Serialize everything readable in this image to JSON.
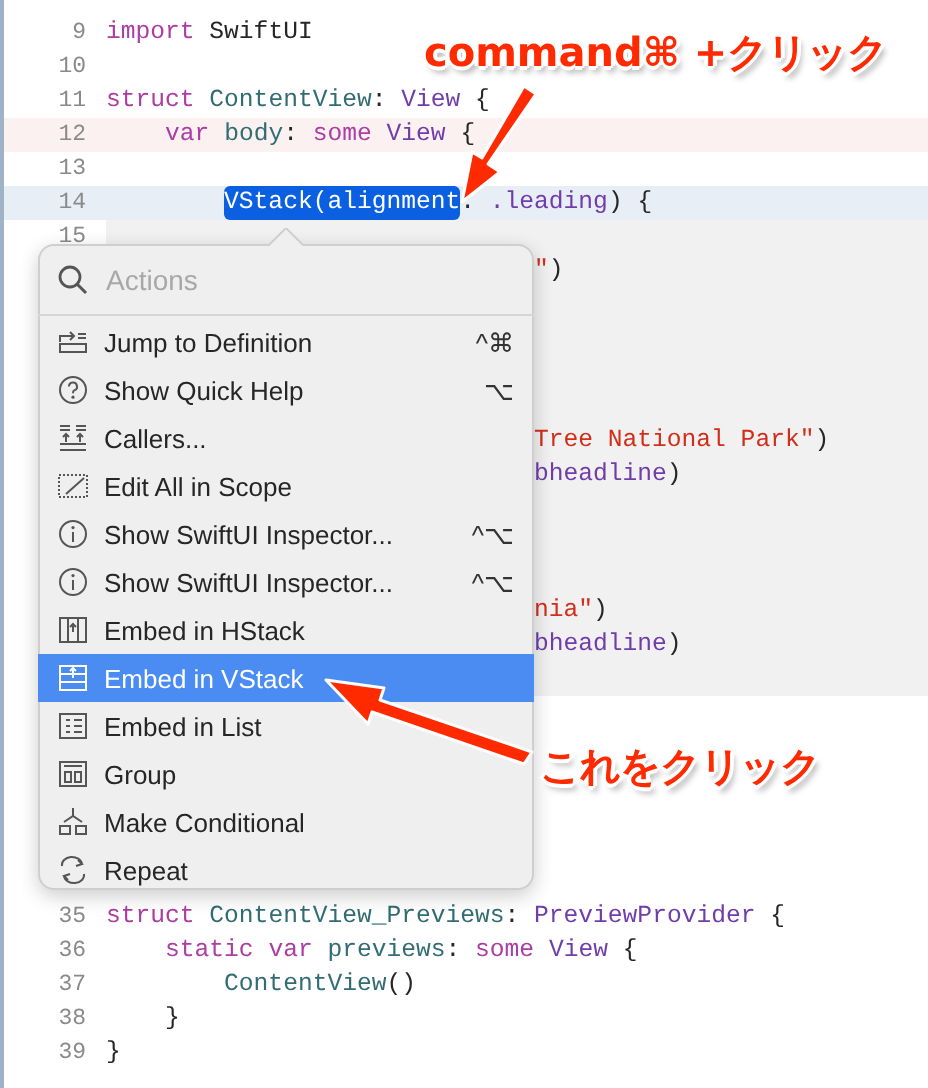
{
  "editor": {
    "lines": [
      {
        "number": "9",
        "tokens": [
          {
            "kind": "keyword",
            "text": "import"
          },
          {
            "kind": "plain",
            "text": " SwiftUI"
          }
        ]
      },
      {
        "number": "10"
      },
      {
        "number": "11",
        "tokens": [
          {
            "kind": "keyword",
            "text": "struct"
          },
          {
            "kind": "decl",
            "text": " ContentView"
          },
          {
            "kind": "plain",
            "text": ": "
          },
          {
            "kind": "type",
            "text": "View"
          },
          {
            "kind": "plain",
            "text": " {"
          }
        ]
      },
      {
        "number": "12",
        "color": "#fcf1f1",
        "tokens": [
          {
            "kind": "keyword",
            "text": "    var"
          },
          {
            "kind": "decl",
            "text": " body"
          },
          {
            "kind": "plain",
            "text": ": "
          },
          {
            "kind": "keyword",
            "text": "some"
          },
          {
            "kind": "type",
            "text": " View"
          },
          {
            "kind": "plain",
            "text": " {"
          }
        ]
      },
      {
        "number": "13"
      },
      {
        "number": "14",
        "color": "#e8eef6",
        "tokens": [
          {
            "kind": "selected",
            "text": "        VStack(alignment"
          },
          {
            "kind": "plain",
            "text": ": "
          },
          {
            "kind": "type",
            "text": ".leading"
          },
          {
            "kind": "plain",
            "text": ") {"
          }
        ]
      },
      {
        "number": "15",
        "color": "#f1f1f1"
      },
      {
        "color": "#f1f1f1",
        "partial": true,
        "tokens": [
          {
            "kind": "string",
            "text": "\""
          },
          {
            "kind": "plain",
            "text": ")"
          }
        ]
      },
      {
        "color": "#f1f1f1"
      },
      {
        "color": "#f1f1f1"
      },
      {
        "color": "#f1f1f1"
      },
      {
        "color": "#f1f1f1"
      },
      {
        "color": "#f1f1f1",
        "partial": true,
        "tokens": [
          {
            "kind": "string",
            "text": "Tree National Park\""
          },
          {
            "kind": "plain",
            "text": ")"
          }
        ]
      },
      {
        "color": "#f1f1f1",
        "partial": true,
        "tokens": [
          {
            "kind": "type",
            "text": "bheadline"
          },
          {
            "kind": "plain",
            "text": ")"
          }
        ]
      },
      {
        "color": "#f1f1f1"
      },
      {
        "color": "#f1f1f1"
      },
      {
        "color": "#f1f1f1"
      },
      {
        "color": "#f1f1f1",
        "partial": true,
        "tokens": [
          {
            "kind": "string",
            "text": "nia\""
          },
          {
            "kind": "plain",
            "text": ")"
          }
        ]
      },
      {
        "color": "#f1f1f1",
        "partial": true,
        "tokens": [
          {
            "kind": "type",
            "text": "bheadline"
          },
          {
            "kind": "plain",
            "text": ")"
          }
        ]
      },
      {
        "color": "#f1f1f1"
      }
    ],
    "lines_below": [
      {
        "number": "35",
        "tokens": [
          {
            "kind": "keyword",
            "text": "struct"
          },
          {
            "kind": "decl",
            "text": " ContentView_Previews"
          },
          {
            "kind": "plain",
            "text": ": "
          },
          {
            "kind": "type",
            "text": "PreviewProvider"
          },
          {
            "kind": "plain",
            "text": " {"
          }
        ]
      },
      {
        "number": "36",
        "tokens": [
          {
            "kind": "keyword",
            "text": "    static"
          },
          {
            "kind": "keyword",
            "text": " var"
          },
          {
            "kind": "decl",
            "text": " previews"
          },
          {
            "kind": "plain",
            "text": ": "
          },
          {
            "kind": "keyword",
            "text": "some"
          },
          {
            "kind": "type",
            "text": " View"
          },
          {
            "kind": "plain",
            "text": " {"
          }
        ]
      },
      {
        "number": "37",
        "tokens": [
          {
            "kind": "call",
            "text": "        ContentView"
          },
          {
            "kind": "plain",
            "text": "()"
          }
        ]
      },
      {
        "number": "38",
        "tokens": [
          {
            "kind": "plain",
            "text": "    }"
          }
        ]
      },
      {
        "number": "39",
        "tokens": [
          {
            "kind": "plain",
            "text": "}"
          }
        ]
      }
    ]
  },
  "menu": {
    "search": {
      "placeholder": "Actions"
    },
    "items": [
      {
        "label": "Jump to Definition",
        "shortcut": "^⌘",
        "selected": false
      },
      {
        "label": "Show Quick Help",
        "shortcut": "⌥",
        "selected": false
      },
      {
        "label": "Callers...",
        "selected": false
      },
      {
        "label": "Edit All in Scope",
        "selected": false
      },
      {
        "label": "Show SwiftUI Inspector...",
        "shortcut": "^⌥",
        "selected": false
      },
      {
        "label": "Show SwiftUI Inspector...",
        "shortcut": "^⌥",
        "selected": false
      },
      {
        "label": "Embed in HStack",
        "selected": false
      },
      {
        "label": "Embed in VStack",
        "selected": true
      },
      {
        "label": "Embed in List",
        "selected": false
      },
      {
        "label": "Group",
        "selected": false
      },
      {
        "label": "Make Conditional",
        "selected": false
      },
      {
        "label": "Repeat",
        "selected": false
      }
    ]
  },
  "annotations": [
    {
      "text": "command⌘ +クリック"
    },
    {
      "text": "これをクリック"
    }
  ]
}
